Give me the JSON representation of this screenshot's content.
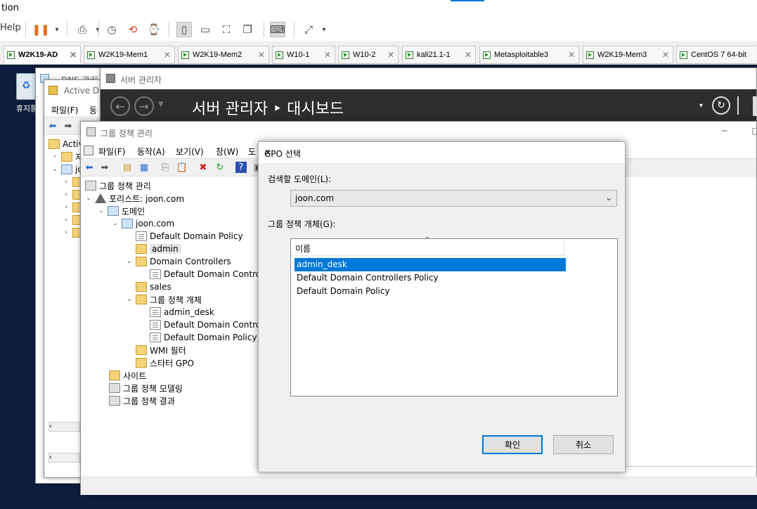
{
  "vmware": {
    "title_fragment": "tion",
    "menu_help": "Help",
    "tabs": [
      {
        "label": "W2K19-AD",
        "active": true
      },
      {
        "label": "W2K19-Mem1"
      },
      {
        "label": "W2K19-Mem2"
      },
      {
        "label": "W10-1"
      },
      {
        "label": "W10-2"
      },
      {
        "label": "kali21.1-1"
      },
      {
        "label": "Metasploitable3"
      },
      {
        "label": "W2K19-Mem3"
      },
      {
        "label": "CentOS 7 64-bit"
      }
    ],
    "close_glyph": "✕"
  },
  "desktop": {
    "recycle_bin_label": "휴지통"
  },
  "dns_window": {
    "title": "DNS 관리"
  },
  "ad_window": {
    "title": "Active Di",
    "menu_file": "파일(F)",
    "menu_action": "동",
    "tree_root": "Activ",
    "tree_item2": "저",
    "tree_item3": "jo"
  },
  "server_manager": {
    "title": "서버 관리자",
    "breadcrumb": "서버 관리자 ‣ 대시보드"
  },
  "gpm": {
    "title": "그룹 정책 관리",
    "menu": [
      "파일(F)",
      "동작(A)",
      "보기(V)",
      "창(W)",
      "도"
    ],
    "tree": {
      "root": "그룹 정책 관리",
      "forest": "포리스트: joon.com",
      "domains": "도메인",
      "domain": "joon.com",
      "default_domain_policy": "Default Domain Policy",
      "admin": "admin",
      "domain_controllers": "Domain Controllers",
      "default_dc_policy_truncated": "Default Domain Controll",
      "sales": "sales",
      "gpo_objects": "그룹 정책 개체",
      "admin_desk": "admin_desk",
      "gpo_dc_policy_truncated": "Default Domain Controll",
      "gpo_default_domain_policy": "Default Domain Policy",
      "wmi_filters": "WMI 필터",
      "starter_gpo": "스타터 GPO",
      "sites": "사이트",
      "modeling": "그룹 정책 모델링",
      "results": "그룹 정책 결과"
    }
  },
  "dialog": {
    "title": "GPO 선택",
    "domain_label": "검색할 도메인(L):",
    "domain_value": "joon.com",
    "gpo_label": "그룹 정책 개체(G):",
    "column_name": "이름",
    "sort_glyph": "^",
    "items": [
      "admin_desk",
      "Default Domain Controllers Policy",
      "Default Domain Policy"
    ],
    "selected_index": 0,
    "ok": "확인",
    "cancel": "취소",
    "close_glyph": "✕"
  }
}
